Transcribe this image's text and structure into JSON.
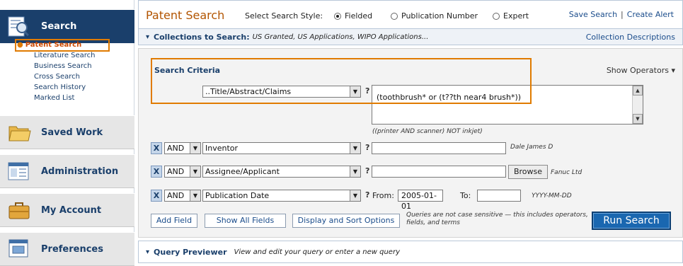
{
  "sidebar": {
    "sections": [
      {
        "label": "Search",
        "icon": "search-document-icon"
      },
      {
        "label": "Saved Work",
        "icon": "folder-icon"
      },
      {
        "label": "Administration",
        "icon": "admin-panel-icon"
      },
      {
        "label": "My Account",
        "icon": "briefcase-icon"
      },
      {
        "label": "Preferences",
        "icon": "preferences-window-icon"
      }
    ],
    "sub_items": [
      "Patent Search",
      "Literature Search",
      "Business Search",
      "Cross Search",
      "Search History",
      "Marked List"
    ]
  },
  "header": {
    "title": "Patent Search",
    "style_label": "Select Search Style:",
    "styles": [
      {
        "label": "Fielded",
        "checked": true
      },
      {
        "label": "Publication Number",
        "checked": false
      },
      {
        "label": "Expert",
        "checked": false
      }
    ],
    "save_search": "Save Search",
    "separator": "|",
    "create_alert": "Create Alert"
  },
  "collections": {
    "label": "Collections to Search:",
    "value": "US Granted, US Applications, WIPO Applications...",
    "link": "Collection Descriptions"
  },
  "criteria": {
    "title": "Search Criteria",
    "show_operators": "Show Operators",
    "first_field": "..Title/Abstract/Claims",
    "first_query": "(toothbrush* or (t??th near4 brush*))",
    "first_hint": "((printer AND scanner) NOT inkjet)",
    "rows": [
      {
        "operator": "AND",
        "field": "Inventor",
        "value": "",
        "hint": "Dale James D"
      },
      {
        "operator": "AND",
        "field": "Assignee/Applicant",
        "value": "",
        "browse": "Browse",
        "hint": "Fanuc Ltd"
      },
      {
        "operator": "AND",
        "field": "Publication Date",
        "from_label": "From:",
        "from_value": "2005-01-01",
        "to_label": "To:",
        "to_value": "",
        "hint": "YYYY-MM-DD"
      }
    ],
    "remove_symbol": "X",
    "help_symbol": "?"
  },
  "actions": {
    "add_field": "Add Field",
    "show_all_fields": "Show All Fields",
    "display_sort": "Display and Sort Options",
    "note": "Queries are not case sensitive — this includes operators, fields, and terms",
    "run_search": "Run Search"
  },
  "previewer": {
    "label": "Query Previewer",
    "hint": "View and edit your query or enter a new query"
  },
  "colors": {
    "navy": "#1a3f6b",
    "orange_highlight": "#e07b00",
    "title_orange": "#b25400",
    "run_button_blue": "#1a67b0"
  }
}
